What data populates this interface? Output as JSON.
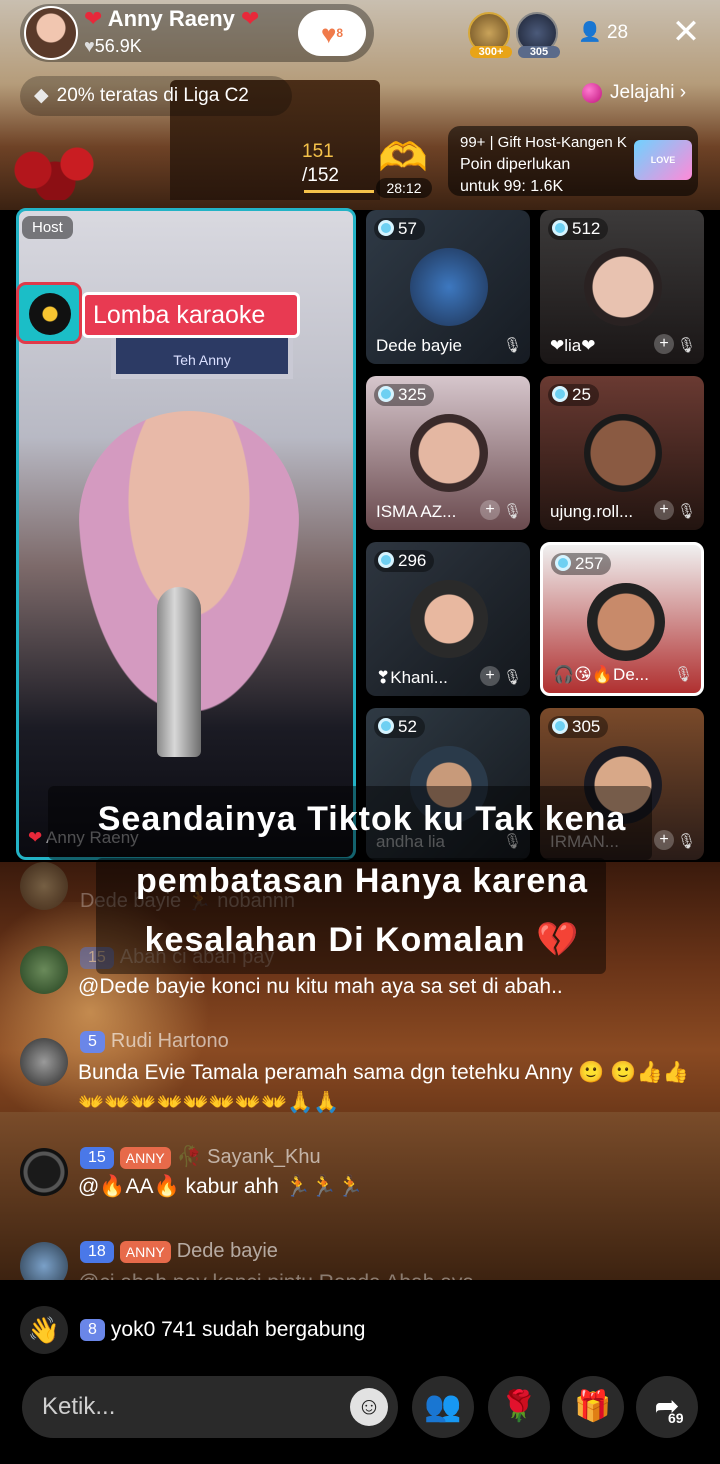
{
  "host": {
    "name": "Anny Raeny",
    "likes": "56.9K",
    "follow_count": "8",
    "league": "20% teratas di Liga C2"
  },
  "top_viewers": [
    {
      "badge": "300+"
    },
    {
      "badge": "305"
    }
  ],
  "viewer_count": "28",
  "explore_label": "Jelajahi",
  "progress": {
    "current": "151",
    "total": "/152"
  },
  "timer": "28:12",
  "gift_goal": {
    "line1": "99+ | Gift Host-Kangen K",
    "line2": "Poin diperlukan",
    "line3": "untuk 99: 1.6K",
    "image_text": "LOVE"
  },
  "host_tile": {
    "badge": "Host",
    "activity": "Lomba karaoke",
    "frame_text": "Teh Anny",
    "caption": "Anny Raeny"
  },
  "guests": [
    {
      "score": "57",
      "name": "Dede bayie"
    },
    {
      "score": "512",
      "name": "❤lia❤"
    },
    {
      "score": "325",
      "name": "ISMA AZ..."
    },
    {
      "score": "25",
      "name": "ujung.roll..."
    },
    {
      "score": "296",
      "name": "❣Khani..."
    },
    {
      "score": "257",
      "name": "🎧😘🔥De..."
    },
    {
      "score": "52",
      "name": "andha lia"
    },
    {
      "score": "305",
      "name": "IRMAN..."
    }
  ],
  "lyrics": [
    "Seandainya Tiktok ku Tak kena",
    "pembatasan Hanya karena",
    "kesalahan Di Komalan 💔"
  ],
  "chat": [
    {
      "head": "Dede bayie 🏃 nobannn",
      "text": ""
    },
    {
      "level": "15",
      "head": "Abah ci abah pay",
      "text": "@Dede bayie konci nu kitu mah aya sa set di abah.."
    },
    {
      "level": "5",
      "head": "Rudi Hartono",
      "text": "Bunda Evie Tamala peramah sama dgn tetehku Anny 🙂 🙂👍👍👐👐👐👐👐👐👐👐🙏🙏"
    },
    {
      "level": "15",
      "fan": "ANNY",
      "head": "🥀 Sayank_Khu",
      "text": "@🔥AA🔥 kabur ahh 🏃🏃🏃"
    },
    {
      "level": "18",
      "fan": "ANNY",
      "head": "Dede bayie",
      "text": "@ci abah pay konci pintu Randa Abah aya"
    }
  ],
  "join": {
    "level": "8",
    "text": "yok0 741 sudah bergabung"
  },
  "input_placeholder": "Ketik...",
  "share_count": "69",
  "colors": {
    "accent": "#23b3c6",
    "badge_red": "#e83a52",
    "level_blue": "#4a78e8",
    "gold": "#f5c24a"
  }
}
